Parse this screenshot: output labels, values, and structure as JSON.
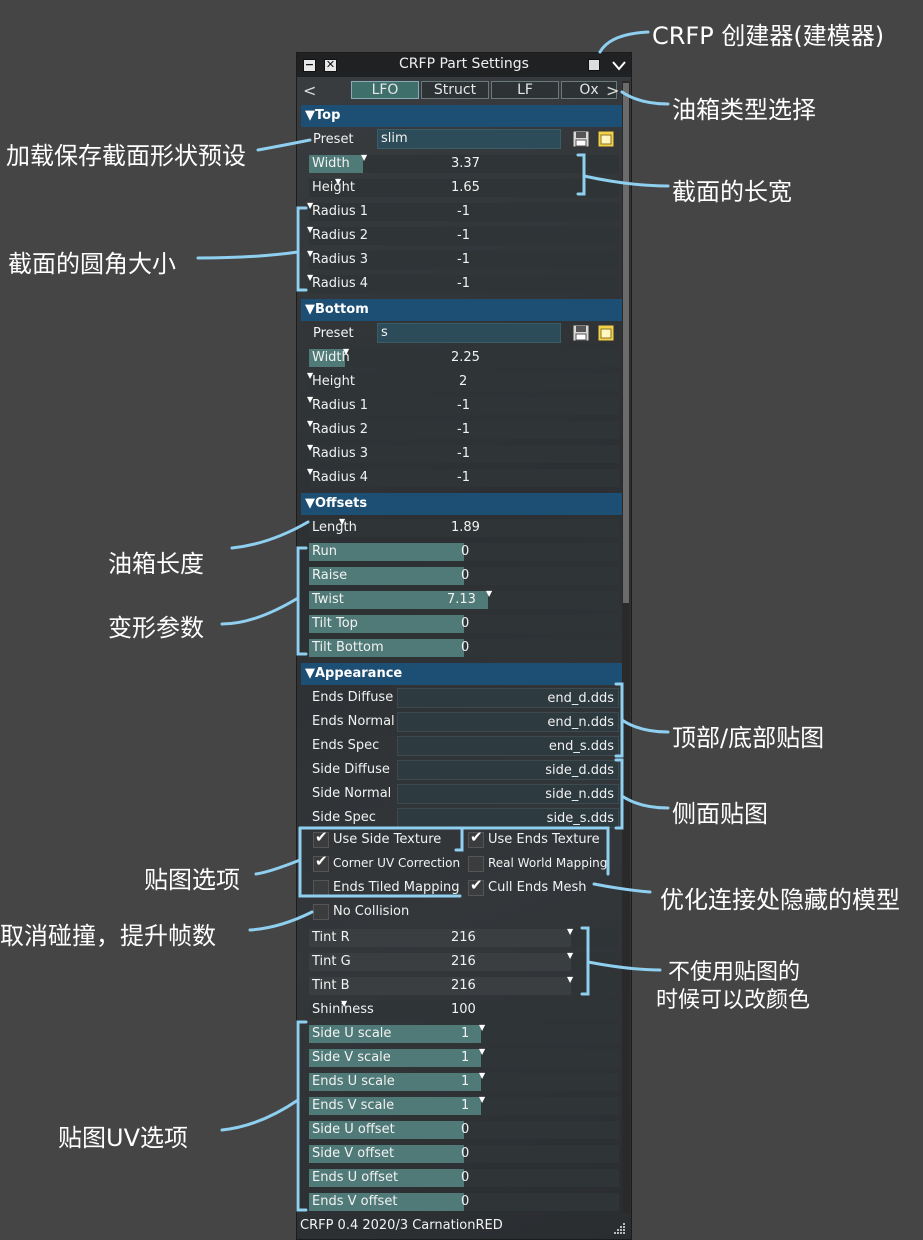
{
  "window": {
    "title": "CRFP Part Settings",
    "min_glyph": "−",
    "close_glyph": "✕",
    "footer": "CRFP 0.4 2020/3 CarnationRED"
  },
  "tabs": {
    "prev": "<",
    "next": ">",
    "items": [
      "LFO",
      "Struct",
      "LF",
      "Ox"
    ]
  },
  "top": {
    "header": "▼Top",
    "preset_label": "Preset",
    "preset_value": "slim",
    "rows": [
      {
        "label": "Width",
        "value": "3.37"
      },
      {
        "label": "Height",
        "value": "1.65"
      },
      {
        "label": "Radius 1",
        "value": "-1"
      },
      {
        "label": "Radius 2",
        "value": "-1"
      },
      {
        "label": "Radius 3",
        "value": "-1"
      },
      {
        "label": "Radius 4",
        "value": "-1"
      }
    ]
  },
  "bottom": {
    "header": "▼Bottom",
    "preset_label": "Preset",
    "preset_value": "s",
    "rows": [
      {
        "label": "Width",
        "value": "2.25"
      },
      {
        "label": "Height",
        "value": "2"
      },
      {
        "label": "Radius 1",
        "value": "-1"
      },
      {
        "label": "Radius 2",
        "value": "-1"
      },
      {
        "label": "Radius 3",
        "value": "-1"
      },
      {
        "label": "Radius 4",
        "value": "-1"
      }
    ]
  },
  "offsets": {
    "header": "▼Offsets",
    "rows": [
      {
        "label": "Length",
        "value": "1.89"
      },
      {
        "label": "Run",
        "value": "0"
      },
      {
        "label": "Raise",
        "value": "0"
      },
      {
        "label": "Twist",
        "value": "7.13"
      },
      {
        "label": "Tilt Top",
        "value": "0"
      },
      {
        "label": "Tilt Bottom",
        "value": "0"
      }
    ]
  },
  "appearance": {
    "header": "▼Appearance",
    "textures": [
      {
        "label": "Ends Diffuse",
        "value": "end_d.dds"
      },
      {
        "label": "Ends Normal",
        "value": "end_n.dds"
      },
      {
        "label": "Ends Spec",
        "value": "end_s.dds"
      },
      {
        "label": "Side Diffuse",
        "value": "side_d.dds"
      },
      {
        "label": "Side Normal",
        "value": "side_n.dds"
      },
      {
        "label": "Side Spec",
        "value": "side_s.dds"
      }
    ],
    "checkboxes": [
      {
        "label": "Use Side Texture",
        "checked": true
      },
      {
        "label": "Use Ends Texture",
        "checked": true
      },
      {
        "label": "Corner UV Correction",
        "checked": true
      },
      {
        "label": "Real World Mapping",
        "checked": false
      },
      {
        "label": "Ends Tiled Mapping",
        "checked": false
      },
      {
        "label": "Cull Ends Mesh",
        "checked": true
      },
      {
        "label": "No Collision",
        "checked": false
      }
    ],
    "checkmark": "✔",
    "tint": [
      {
        "label": "Tint R",
        "value": "216"
      },
      {
        "label": "Tint G",
        "value": "216"
      },
      {
        "label": "Tint B",
        "value": "216"
      }
    ],
    "shininess": {
      "label": "Shininess",
      "value": "100"
    },
    "uv": [
      {
        "label": "Side U scale",
        "value": "1"
      },
      {
        "label": "Side V scale",
        "value": "1"
      },
      {
        "label": "Ends U scale",
        "value": "1"
      },
      {
        "label": "Ends V scale",
        "value": "1"
      },
      {
        "label": "Side U offset",
        "value": "0"
      },
      {
        "label": "Side V offset",
        "value": "0"
      },
      {
        "label": "Ends U offset",
        "value": "0"
      },
      {
        "label": "Ends V offset",
        "value": "0"
      }
    ]
  },
  "annotations": {
    "creator": "CRFP 创建器(建模器)",
    "tank_type": "油箱类型选择",
    "preset": "加载保存截面形状预设",
    "dims": "截面的长宽",
    "radius": "截面的圆角大小",
    "length": "油箱长度",
    "deform": "变形参数",
    "ends_tex": "顶部/底部贴图",
    "side_tex": "侧面贴图",
    "tex_opts": "贴图选项",
    "cull": "优化连接处隐藏的模型",
    "collision": "取消碰撞，提升帧数",
    "tint_1": "不使用贴图的",
    "tint_2": "时候可以改颜色",
    "uv": "贴图UV选项"
  },
  "colors": {
    "section_header": "#1d4f75",
    "slider_fill": "#4f7a77",
    "annotation_line": "#8fcfef",
    "background": "#454545"
  }
}
